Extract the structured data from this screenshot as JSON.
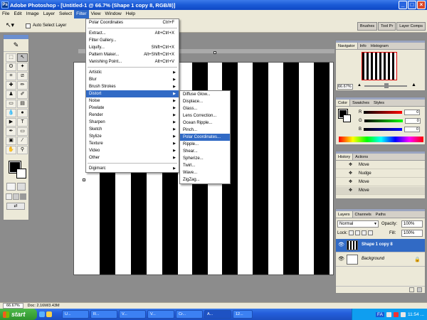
{
  "window": {
    "title": "Adobe Photoshop - [Untitled-1 @ 66.7% (Shape 1 copy 8, RGB/8)]"
  },
  "menubar": [
    "File",
    "Edit",
    "Image",
    "Layer",
    "Select",
    "Filter",
    "View",
    "Window",
    "Help"
  ],
  "optionsbar": {
    "auto_select_label": "Auto Select Layer"
  },
  "palette_well": [
    "Brushes",
    "Tool Pr",
    "Layer Comps"
  ],
  "filter_menu": {
    "last_filter": "Polar Coordinates",
    "last_filter_shortcut": "Ctrl+F",
    "extract": "Extract...",
    "extract_shortcut": "Alt+Ctrl+X",
    "filter_gallery": "Filter Gallery...",
    "liquify": "Liquify...",
    "liquify_shortcut": "Shift+Ctrl+X",
    "pattern_maker": "Pattern Maker...",
    "pattern_maker_shortcut": "Alt+Shift+Ctrl+X",
    "vanishing_point": "Vanishing Point...",
    "vanishing_point_shortcut": "Alt+Ctrl+V",
    "groups": [
      "Artistic",
      "Blur",
      "Brush Strokes",
      "Distort",
      "Noise",
      "Pixelate",
      "Render",
      "Sharpen",
      "Sketch",
      "Stylize",
      "Texture",
      "Video",
      "Other"
    ],
    "digimarc": "Digimarc"
  },
  "distort_menu": [
    "Diffuse Glow...",
    "Displace...",
    "Glass...",
    "Lens Correction...",
    "Ocean Ripple...",
    "Pinch...",
    "Polar Coordinates...",
    "Ripple...",
    "Shear...",
    "Spherize...",
    "Twirl...",
    "Wave...",
    "ZigZag..."
  ],
  "navigator": {
    "tabs": [
      "Navigator",
      "Info",
      "Histogram"
    ],
    "zoom": "66.67%"
  },
  "color_panel": {
    "tabs": [
      "Color",
      "Swatches",
      "Styles"
    ],
    "channels": [
      {
        "label": "R",
        "value": "0"
      },
      {
        "label": "G",
        "value": "0"
      },
      {
        "label": "B",
        "value": "0"
      }
    ]
  },
  "history": {
    "tabs": [
      "History",
      "Actions"
    ],
    "items": [
      "Move",
      "Nudge",
      "Move",
      "Move"
    ]
  },
  "layers": {
    "tabs": [
      "Layers",
      "Channels",
      "Paths"
    ],
    "blend_mode": "Normal",
    "opacity_label": "Opacity:",
    "opacity": "100%",
    "lock_label": "Lock:",
    "fill_label": "Fill:",
    "fill": "100%",
    "items": [
      "Shape 1 copy 8",
      "Background"
    ]
  },
  "status": {
    "zoom": "66.67%",
    "doc": "Doc: 2.16M/3.43M"
  },
  "taskbar": {
    "start": "start",
    "buttons": [
      "U...",
      "R...",
      "V...",
      "V...",
      "Cr...",
      "A...",
      "12..."
    ],
    "lang": "FA",
    "clock": "11:54 ..."
  }
}
